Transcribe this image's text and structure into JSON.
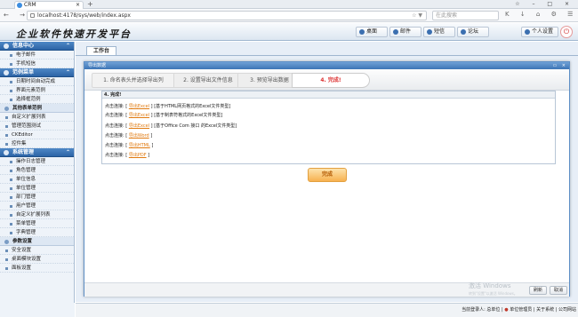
{
  "browser": {
    "tab_title": "CRM",
    "tab_close": "×",
    "new_tab": "+",
    "window_controls": "☆ – □ ×",
    "nav_glyphs": "← → ⌂",
    "url": "localhost:4178/sys/web/index.aspx",
    "url_right": "☆ ▼",
    "search_placeholder": "在此搜索",
    "toolbar_icons": "K ↓ ⌂ ⚙ ☰"
  },
  "app": {
    "title": "企业软件快速开发平台",
    "header_buttons": [
      {
        "label": "桌面",
        "icon": "desktop-icon"
      },
      {
        "label": "邮件",
        "icon": "mail-icon"
      },
      {
        "label": "短信",
        "icon": "sms-icon"
      },
      {
        "label": "论坛",
        "icon": "forum-icon"
      },
      {
        "label": "个人设置",
        "icon": "user-settings-icon"
      }
    ],
    "power_glyph": "⏻"
  },
  "sidebar": {
    "sections": [
      {
        "title": "信息中心",
        "items": [
          "电子邮件",
          "手机短信"
        ]
      },
      {
        "title": "范例菜单",
        "items": [
          "日期时间自动完成",
          "界面元素范例",
          "选择框范例"
        ]
      }
    ],
    "sub_header_1": "其他表单范例",
    "group_items": [
      "自定义扩展列表",
      "管理范围测试",
      "CKEditor",
      "控件集"
    ],
    "system": {
      "title": "系统管理",
      "items": [
        "操作日志管理",
        "角色管理",
        "单位信息",
        "单位管理",
        "部门管理",
        "用户管理",
        "自定义扩展列表",
        "菜单管理",
        "字典管理"
      ]
    },
    "sub_header_2": "参数设置",
    "param_items": [
      "安全设置",
      "桌面模块设置",
      "面板设置"
    ],
    "chevron": "⌃"
  },
  "workarea": {
    "tab_label": "工作台"
  },
  "dialog": {
    "title": "导出数据",
    "window_buttons": "▭ ×",
    "steps": [
      "1. 命名表头并选择导出列",
      "2. 设置导出文件信息",
      "3. 预览导出数据",
      "4. 完成!"
    ],
    "panel_title": "4. 完成!",
    "rows": [
      {
        "label": "点击连接:",
        "link": "导出Excel",
        "note": "[基于HTML网页格式的Excel文件类型]"
      },
      {
        "label": "点击连接:",
        "link": "导出Excel",
        "note": "[基于制表符格式的Excel文件类型]"
      },
      {
        "label": "点击连接:",
        "link": "导出Excel",
        "note": "[基于Office Com 接口 的Excel文件类型]"
      },
      {
        "label": "点击连接:",
        "link": "导出Word",
        "note": ""
      },
      {
        "label": "点击连接:",
        "link": "导出HTML",
        "note": ""
      },
      {
        "label": "点击连接:",
        "link": "导出PDF",
        "note": ""
      }
    ],
    "finish_button": "完成",
    "footer_ok": "刷新",
    "footer_cancel": "取消",
    "watermark": "激活 Windows",
    "watermark_sub": "转到\"设置\"以激活 Windows。"
  },
  "statusbar": {
    "text_before": "当前登录人:",
    "user": "总单位",
    "unit": "单位管理员",
    "about": "关于系统",
    "company": "公司网站"
  }
}
